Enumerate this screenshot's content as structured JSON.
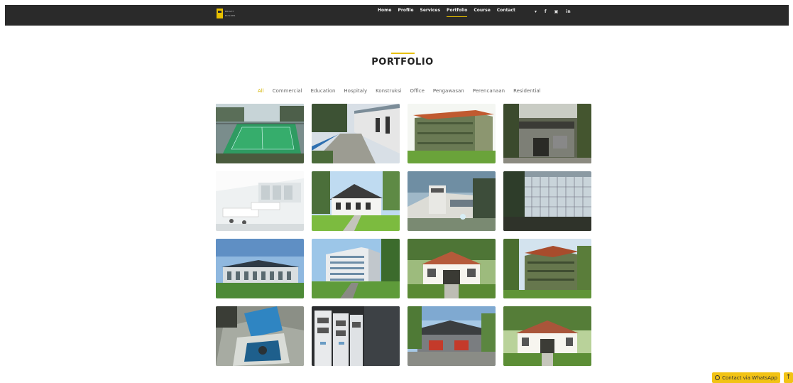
{
  "header": {
    "logo_lines": [
      "BRIGHT",
      "BUILDER"
    ],
    "nav": [
      "Home",
      "Profile",
      "Services",
      "Portfolio",
      "Course",
      "Contact"
    ],
    "active_nav": "Portfolio",
    "social_icons": [
      {
        "name": "twitter-icon",
        "glyph": "▾"
      },
      {
        "name": "facebook-icon",
        "glyph": "f"
      },
      {
        "name": "instagram-icon",
        "glyph": "▣"
      },
      {
        "name": "linkedin-icon",
        "glyph": "in"
      }
    ]
  },
  "section": {
    "title": "PORTFOLIO"
  },
  "filters": [
    "All",
    "Commercial",
    "Education",
    "Hospitaly",
    "Konstruksi",
    "Office",
    "Pengawasan",
    "Perencanaan",
    "Residential"
  ],
  "active_filter": "All",
  "portfolio_items": [
    {
      "name": "tennis-court-photo"
    },
    {
      "name": "walkway-building-photo"
    },
    {
      "name": "green-building-render"
    },
    {
      "name": "building-facade-photo"
    },
    {
      "name": "laboratory-interior-render"
    },
    {
      "name": "white-house-render"
    },
    {
      "name": "modern-building-render"
    },
    {
      "name": "glass-building-photo"
    },
    {
      "name": "school-building-photo"
    },
    {
      "name": "apartment-building-render"
    },
    {
      "name": "colonial-house-render"
    },
    {
      "name": "green-building-render-2"
    },
    {
      "name": "water-pump-pit-photo"
    },
    {
      "name": "electrical-panel-photo"
    },
    {
      "name": "fire-station-render"
    },
    {
      "name": "colonial-house-photo"
    }
  ],
  "floating": {
    "whatsapp_label": "Contact via WhatsApp",
    "whatsapp_icon": "whatsapp-icon",
    "back_to_top_glyph": "↑"
  },
  "colors": {
    "accent": "#e8c000",
    "header_bg": "#2a2a2a",
    "button": "#f2c314"
  }
}
